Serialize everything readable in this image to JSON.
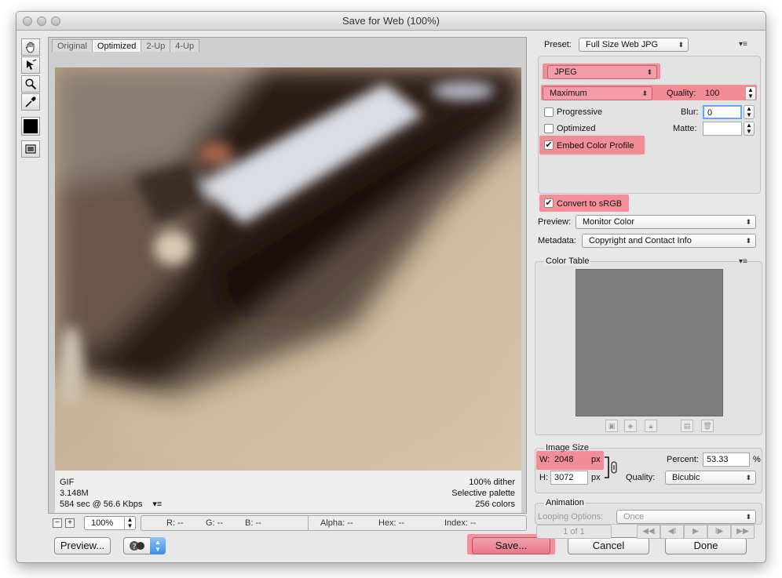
{
  "window": {
    "title": "Save for Web (100%)"
  },
  "tabs": [
    "Original",
    "Optimized",
    "2-Up",
    "4-Up"
  ],
  "image_info": {
    "format": "GIF",
    "size": "3.148M",
    "time": "584 sec @ 56.6 Kbps",
    "menu_glyph": "▾≡",
    "dither": "100% dither",
    "palette": "Selective palette",
    "colors": "256 colors"
  },
  "status_bar": {
    "zoom_minus": "−",
    "zoom_plus": "+",
    "zoom": "100%",
    "r": "R: --",
    "g": "G: --",
    "b": "B: --",
    "alpha": "Alpha: --",
    "hex": "Hex: --",
    "index": "Index: --"
  },
  "buttons": {
    "preview": "Preview...",
    "save": "Save...",
    "cancel": "Cancel",
    "done": "Done"
  },
  "settings": {
    "preset_label": "Preset:",
    "preset_value": "Full Size Web JPG",
    "panel_menu_glyph": "▾≡",
    "format": "JPEG",
    "compression": "Maximum",
    "quality_label": "Quality:",
    "quality_value": "100",
    "progressive_label": "Progressive",
    "blur_label": "Blur:",
    "blur_value": "0",
    "optimized_label": "Optimized",
    "matte_label": "Matte:",
    "embed_profile_label": "Embed Color Profile",
    "convert_srgb_label": "Convert to sRGB",
    "preview_label": "Preview:",
    "preview_value": "Monitor Color",
    "metadata_label": "Metadata:",
    "metadata_value": "Copyright and Contact Info",
    "progressive_checked": false,
    "optimized_checked": false,
    "embed_profile_checked": true,
    "convert_srgb_checked": true
  },
  "color_table": {
    "title": "Color Table",
    "menu_glyph": "▾≡"
  },
  "image_size": {
    "title": "Image Size",
    "w_label": "W:",
    "w_value": "2048",
    "h_label": "H:",
    "h_value": "3072",
    "unit": "px",
    "percent_label": "Percent:",
    "percent_value": "53.33",
    "percent_unit": "%",
    "quality_label": "Quality:",
    "quality_value": "Bicubic"
  },
  "animation": {
    "title": "Animation",
    "looping_label": "Looping Options:",
    "looping_value": "Once",
    "frame_counter": "1 of 1"
  },
  "colors": {
    "highlight": "#ff465a",
    "window_bg": "#e8e8e8",
    "color_table_bg": "#7e7e7e",
    "image_tone": "#c7b399"
  },
  "icons": {
    "hand": "hand-tool-icon",
    "slice": "slice-select-tool-icon",
    "zoom": "zoom-tool-icon",
    "eyedropper": "eyedropper-tool-icon",
    "swatch": "eyedropper-color-swatch",
    "toggle_slices": "toggle-slices-icon",
    "help": "help-icon",
    "link": "constrain-proportions-link-icon"
  }
}
